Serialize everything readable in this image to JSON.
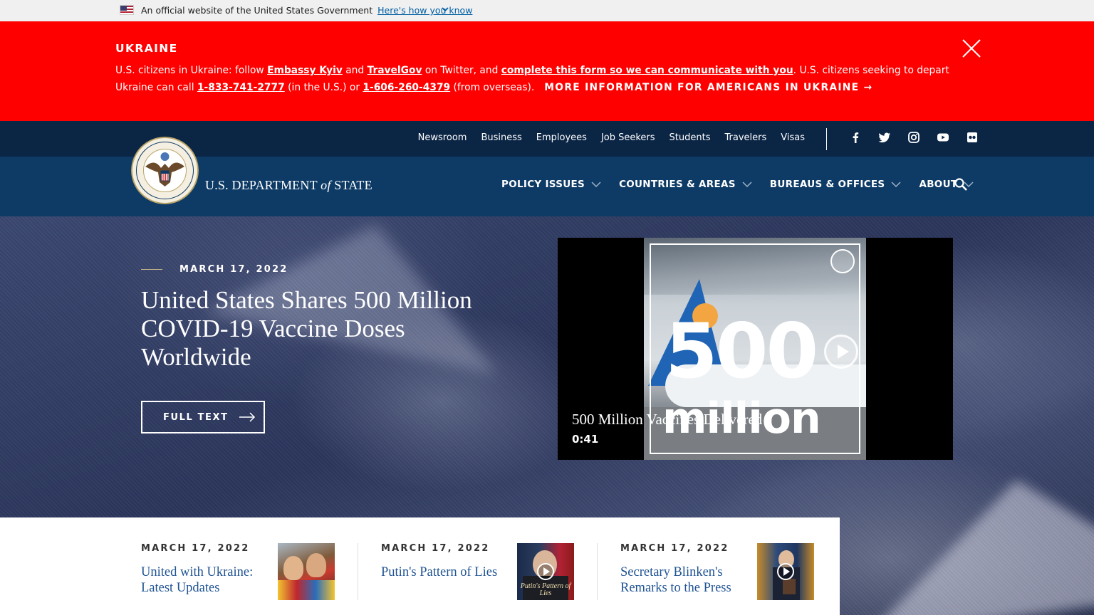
{
  "gov_banner": {
    "text": "An official website of the United States Government",
    "link": "Here's how you know"
  },
  "alert": {
    "title": "UKRAINE",
    "body_1": "U.S. citizens in Ukraine: follow ",
    "link_embassy": "Embassy Kyiv",
    "body_2": " and ",
    "link_travelgov": "TravelGov",
    "body_3": " on Twitter, and ",
    "link_form": "complete this form so we can communicate with you",
    "body_4": ". U.S. citizens seeking to depart Ukraine can call ",
    "phone_us": "1-833-741-2777",
    "body_5": " (in the U.S.) or ",
    "phone_overseas": "1-606-260-4379",
    "body_6": " (from overseas).",
    "more": "MORE INFORMATION FOR AMERICANS IN UKRAINE →",
    "bg_color": "#ff0000"
  },
  "utility_nav": {
    "links": [
      "Newsroom",
      "Business",
      "Employees",
      "Job Seekers",
      "Students",
      "Travelers",
      "Visas"
    ],
    "socials": [
      "facebook-icon",
      "twitter-icon",
      "instagram-icon",
      "youtube-icon",
      "flickr-icon"
    ]
  },
  "header": {
    "dept_name_1": "U.S. DEPARTMENT ",
    "dept_name_of": "of",
    "dept_name_2": " STATE",
    "menu": [
      "POLICY ISSUES",
      "COUNTRIES & AREAS",
      "BUREAUS & OFFICES",
      "ABOUT"
    ],
    "nav_color": "#0e3b66",
    "util_color": "#0b2545"
  },
  "hero": {
    "date": "MARCH 17, 2022",
    "title": "United States Shares 500 Million COVID-19 Vaccine Doses Worldwide",
    "button": "FULL TEXT"
  },
  "video": {
    "overlay_number": "500",
    "overlay_word": "million",
    "title": "500 Million Vaccines Delivered",
    "duration": "0:41"
  },
  "cards": [
    {
      "date": "MARCH 17, 2022",
      "title": "United with Ukraine: Latest Updates"
    },
    {
      "date": "MARCH 17, 2022",
      "title": "Putin's Pattern of Lies",
      "thumb_caption": "Putin's Pattern of Lies"
    },
    {
      "date": "MARCH 17, 2022",
      "title": "Secretary Blinken's Remarks to the Press"
    }
  ],
  "link_color": "#205493"
}
